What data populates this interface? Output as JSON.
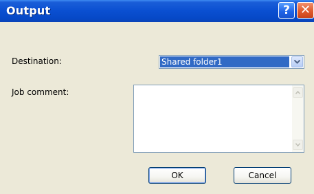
{
  "window": {
    "title": "Output",
    "help_glyph": "?",
    "close_glyph": "✕",
    "colors": {
      "title_bar": "#0a4fd1",
      "dialog_bg": "#ece9d8",
      "selection": "#316ac5",
      "close_button": "#e05a2c"
    }
  },
  "form": {
    "destination_label": "Destination:",
    "destination_value": "Shared folder1",
    "job_comment_label": "Job comment:",
    "job_comment_value": ""
  },
  "buttons": {
    "ok_label": "OK",
    "cancel_label": "Cancel"
  },
  "icons": {
    "help": "help-icon",
    "close": "close-icon",
    "dropdown": "chevron-down-icon",
    "scroll_up": "scroll-up-icon",
    "scroll_down": "scroll-down-icon"
  }
}
